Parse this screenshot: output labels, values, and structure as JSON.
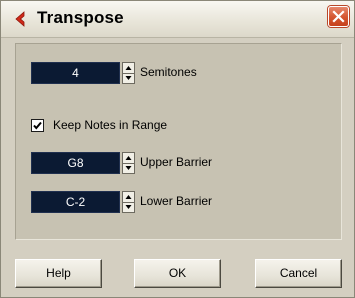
{
  "window": {
    "title": "Transpose",
    "close_icon": "close-x-icon",
    "app_icon": "red-chevron-icon"
  },
  "semitones": {
    "value": "4",
    "label": "Semitones"
  },
  "keep_notes": {
    "checked": true,
    "label": "Keep Notes in Range"
  },
  "upper_barrier": {
    "value": "G8",
    "label": "Upper Barrier"
  },
  "lower_barrier": {
    "value": "C-2",
    "label": "Lower Barrier"
  },
  "buttons": {
    "help": "Help",
    "ok": "OK",
    "cancel": "Cancel"
  },
  "colors": {
    "field_bg": "#0b1a33",
    "close_button": "#d4552f",
    "dialog_bg": "#d4cfc1"
  }
}
